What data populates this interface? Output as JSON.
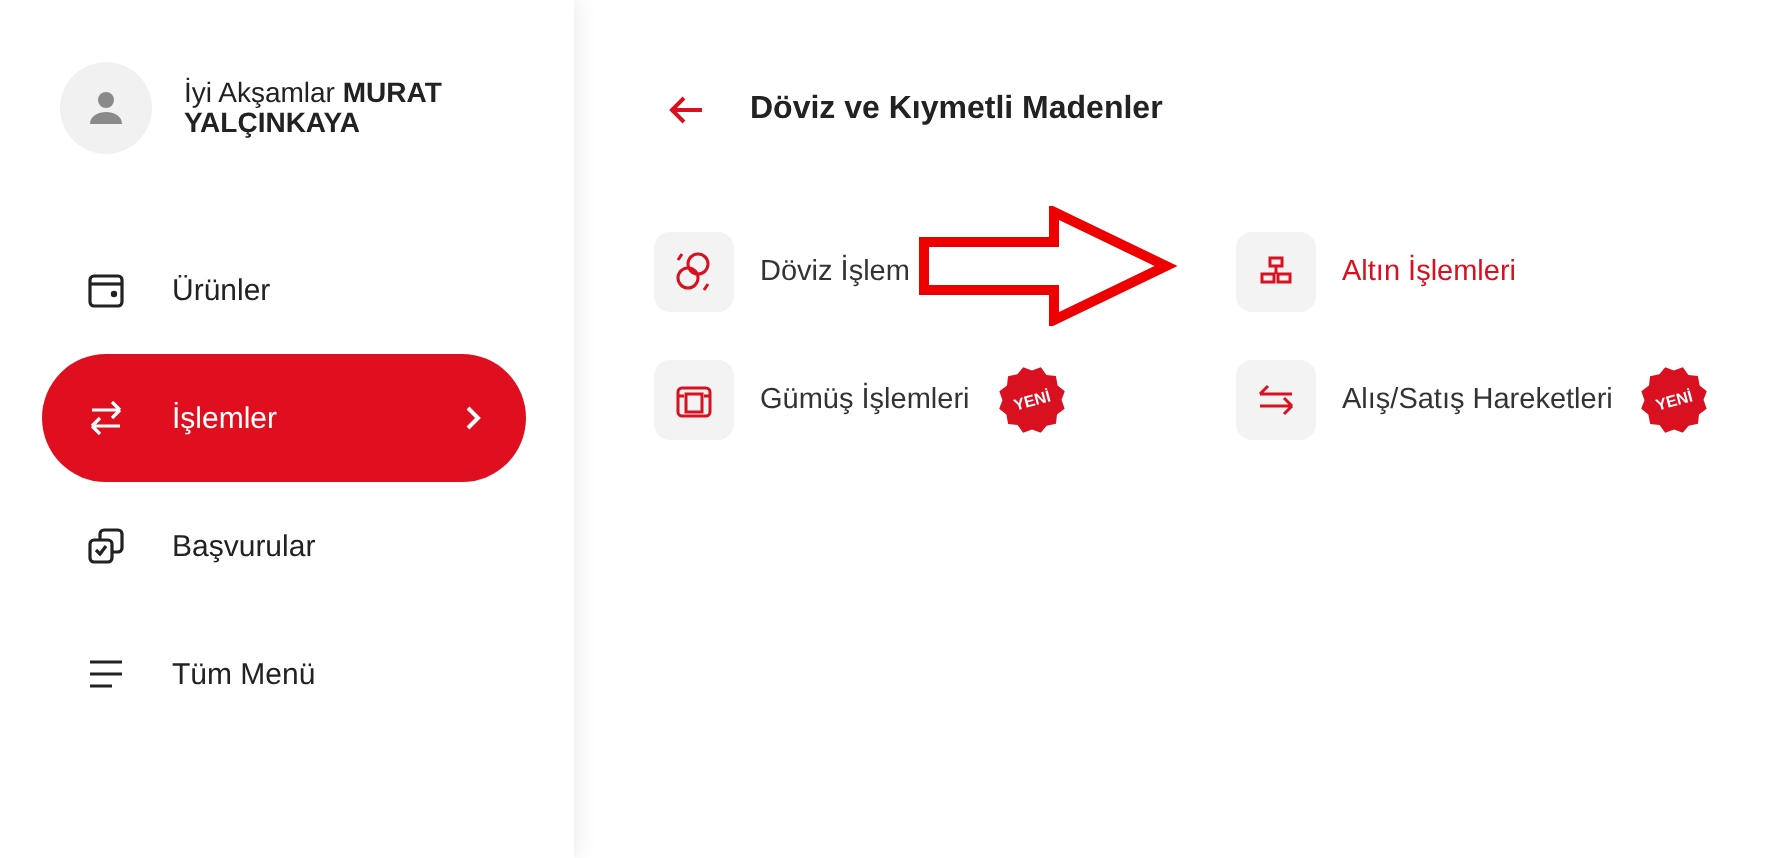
{
  "user": {
    "greeting": "İyi Akşamlar",
    "name": "MURAT YALÇINKAYA"
  },
  "sidebar": {
    "items": [
      {
        "label": "Ürünler",
        "kind": "wallet",
        "selected": false
      },
      {
        "label": "İşlemler",
        "kind": "transfer",
        "selected": true
      },
      {
        "label": "Başvurular",
        "kind": "apply",
        "selected": false
      },
      {
        "label": "Tüm Menü",
        "kind": "menu",
        "selected": false
      }
    ]
  },
  "page": {
    "title": "Döviz ve Kıymetli Madenler",
    "items": [
      {
        "label": "Döviz İşlem",
        "kind": "currency",
        "selected": false
      },
      {
        "label": "Altın İşlemleri",
        "kind": "gold",
        "selected": true
      },
      {
        "label": "Gümüş İşlemleri",
        "kind": "silver",
        "selected": false,
        "badge": "YENİ"
      },
      {
        "label": "Alış/Satış Hareketleri",
        "kind": "exchange",
        "selected": false,
        "badge": "YENİ"
      }
    ]
  }
}
